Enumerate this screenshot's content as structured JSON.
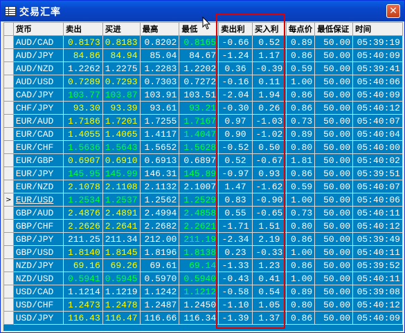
{
  "window": {
    "title": "交易汇率",
    "close_label": "✕"
  },
  "grid": {
    "headers": [
      "货币",
      "卖出",
      "买进",
      "最高",
      "最低",
      "卖出利",
      "买入利",
      "每点价",
      "最低保证",
      "时间"
    ],
    "current_row_marker": ">",
    "rows": [
      {
        "sym": "AUD/CAD",
        "bid": "0.8173",
        "ask": "0.8183",
        "high": "0.8202",
        "low": "0.8165",
        "sell": "-0.66",
        "buy": "0.52",
        "pt": "0.89",
        "margin": "50.00",
        "time": "05:39:19",
        "bidColor": "#ffff00",
        "askColor": "#ffff00",
        "highColor": "#ffffff",
        "lowColor": "#00ff40"
      },
      {
        "sym": "AUD/JPY",
        "bid": "84.86",
        "ask": "84.94",
        "high": "85.04",
        "low": "84.67",
        "sell": "-1.24",
        "buy": "1.17",
        "pt": "0.86",
        "margin": "50.00",
        "time": "05:40:09",
        "bidColor": "#ffff00",
        "askColor": "#ffff00",
        "highColor": "#ffffff",
        "lowColor": "#ffffff"
      },
      {
        "sym": "AUD/NZD",
        "bid": "1.2262",
        "ask": "1.2275",
        "high": "1.2283",
        "low": "1.2202",
        "sell": "0.36",
        "buy": "-0.39",
        "pt": "0.59",
        "margin": "50.00",
        "time": "05:39:41",
        "bidColor": "#ffffff",
        "askColor": "#ffffff",
        "highColor": "#ffffff",
        "lowColor": "#ffffff"
      },
      {
        "sym": "AUD/USD",
        "bid": "0.7289",
        "ask": "0.7293",
        "high": "0.7303",
        "low": "0.7272",
        "sell": "-0.16",
        "buy": "0.11",
        "pt": "1.00",
        "margin": "50.00",
        "time": "05:40:06",
        "bidColor": "#ffff00",
        "askColor": "#ffff00",
        "highColor": "#ffffff",
        "lowColor": "#ffffff"
      },
      {
        "sym": "CAD/JPY",
        "bid": "103.77",
        "ask": "103.87",
        "high": "103.91",
        "low": "103.51",
        "sell": "-2.04",
        "buy": "1.94",
        "pt": "0.86",
        "margin": "50.00",
        "time": "05:40:09",
        "bidColor": "#00ff40",
        "askColor": "#00ff40",
        "highColor": "#ffffff",
        "lowColor": "#ffffff"
      },
      {
        "sym": "CHF/JPY",
        "bid": "93.30",
        "ask": "93.39",
        "high": "93.61",
        "low": "93.21",
        "sell": "-0.30",
        "buy": "0.26",
        "pt": "0.86",
        "margin": "50.00",
        "time": "05:40:12",
        "bidColor": "#ffff00",
        "askColor": "#ffff00",
        "highColor": "#ffffff",
        "lowColor": "#00ff40"
      },
      {
        "sym": "EUR/AUD",
        "bid": "1.7186",
        "ask": "1.7201",
        "high": "1.7255",
        "low": "1.7167",
        "sell": "0.97",
        "buy": "-1.03",
        "pt": "0.73",
        "margin": "50.00",
        "time": "05:40:07",
        "bidColor": "#ffff00",
        "askColor": "#ffff00",
        "highColor": "#ffffff",
        "lowColor": "#00ff40"
      },
      {
        "sym": "EUR/CAD",
        "bid": "1.4055",
        "ask": "1.4065",
        "high": "1.4117",
        "low": "1.4047",
        "sell": "0.90",
        "buy": "-1.02",
        "pt": "0.89",
        "margin": "50.00",
        "time": "05:40:04",
        "bidColor": "#ffff00",
        "askColor": "#ffff00",
        "highColor": "#ffffff",
        "lowColor": "#00ff40"
      },
      {
        "sym": "EUR/CHF",
        "bid": "1.5636",
        "ask": "1.5643",
        "high": "1.5652",
        "low": "1.5628",
        "sell": "-0.52",
        "buy": "0.50",
        "pt": "0.80",
        "margin": "50.00",
        "time": "05:40:00",
        "bidColor": "#00ff40",
        "askColor": "#00ff40",
        "highColor": "#ffffff",
        "lowColor": "#00ff40"
      },
      {
        "sym": "EUR/GBP",
        "bid": "0.6907",
        "ask": "0.6910",
        "high": "0.6913",
        "low": "0.6897",
        "sell": "0.52",
        "buy": "-0.67",
        "pt": "1.81",
        "margin": "50.00",
        "time": "05:40:02",
        "bidColor": "#ffff00",
        "askColor": "#ffff00",
        "highColor": "#ffffff",
        "lowColor": "#ffffff"
      },
      {
        "sym": "EUR/JPY",
        "bid": "145.95",
        "ask": "145.99",
        "high": "146.31",
        "low": "145.89",
        "sell": "-0.97",
        "buy": "0.93",
        "pt": "0.86",
        "margin": "50.00",
        "time": "05:39:51",
        "bidColor": "#00ff40",
        "askColor": "#00ff40",
        "highColor": "#ffffff",
        "lowColor": "#00ff40"
      },
      {
        "sym": "EUR/NZD",
        "bid": "2.1078",
        "ask": "2.1108",
        "high": "2.1132",
        "low": "2.1007",
        "sell": "1.47",
        "buy": "-1.62",
        "pt": "0.59",
        "margin": "50.00",
        "time": "05:40:07",
        "bidColor": "#ffff00",
        "askColor": "#ffff00",
        "highColor": "#ffffff",
        "lowColor": "#ffffff"
      },
      {
        "sym": "EUR/USD",
        "bid": "1.2534",
        "ask": "1.2537",
        "high": "1.2562",
        "low": "1.2529",
        "sell": "0.83",
        "buy": "-0.90",
        "pt": "1.00",
        "margin": "50.00",
        "time": "05:40:06",
        "bidColor": "#00ff40",
        "askColor": "#00ff40",
        "highColor": "#ffffff",
        "lowColor": "#00ff40",
        "current": true
      },
      {
        "sym": "GBP/AUD",
        "bid": "2.4876",
        "ask": "2.4891",
        "high": "2.4994",
        "low": "2.4858",
        "sell": "0.55",
        "buy": "-0.65",
        "pt": "0.73",
        "margin": "50.00",
        "time": "05:40:11",
        "bidColor": "#ffff00",
        "askColor": "#ffff00",
        "highColor": "#ffffff",
        "lowColor": "#00ff40"
      },
      {
        "sym": "GBP/CHF",
        "bid": "2.2626",
        "ask": "2.2641",
        "high": "2.2682",
        "low": "2.2621",
        "sell": "-1.71",
        "buy": "1.51",
        "pt": "0.80",
        "margin": "50.00",
        "time": "05:40:12",
        "bidColor": "#ffff00",
        "askColor": "#ffff00",
        "highColor": "#ffffff",
        "lowColor": "#00ff40"
      },
      {
        "sym": "GBP/JPY",
        "bid": "211.25",
        "ask": "211.34",
        "high": "212.00",
        "low": "211.19",
        "sell": "-2.34",
        "buy": "2.19",
        "pt": "0.86",
        "margin": "50.00",
        "time": "05:39:49",
        "bidColor": "#ffffff",
        "askColor": "#ffffff",
        "highColor": "#ffffff",
        "lowColor": "#00ff40"
      },
      {
        "sym": "GBP/USD",
        "bid": "1.8140",
        "ask": "1.8145",
        "high": "1.8196",
        "low": "1.8138",
        "sell": "0.23",
        "buy": "-0.33",
        "pt": "1.00",
        "margin": "50.00",
        "time": "05:40:11",
        "bidColor": "#ffff00",
        "askColor": "#ffff00",
        "highColor": "#ffffff",
        "lowColor": "#00ff40"
      },
      {
        "sym": "NZD/JPY",
        "bid": "69.16",
        "ask": "69.26",
        "high": "69.61",
        "low": "69.14",
        "sell": "-1.33",
        "buy": "1.23",
        "pt": "0.86",
        "margin": "50.00",
        "time": "05:39:52",
        "bidColor": "#ffff00",
        "askColor": "#ffff00",
        "highColor": "#ffffff",
        "lowColor": "#00ff40"
      },
      {
        "sym": "NZD/USD",
        "bid": "0.5941",
        "ask": "0.5945",
        "high": "0.5970",
        "low": "0.5940",
        "sell": "-0.43",
        "buy": "0.41",
        "pt": "1.00",
        "margin": "50.00",
        "time": "05:40:11",
        "bidColor": "#00ff40",
        "askColor": "#00ff40",
        "highColor": "#ffffff",
        "lowColor": "#00ff40"
      },
      {
        "sym": "USD/CAD",
        "bid": "1.1214",
        "ask": "1.1219",
        "high": "1.1242",
        "low": "1.1212",
        "sell": "-0.58",
        "buy": "0.54",
        "pt": "0.89",
        "margin": "50.00",
        "time": "05:39:08",
        "bidColor": "#ffffff",
        "askColor": "#ffffff",
        "highColor": "#ffffff",
        "lowColor": "#00ff40"
      },
      {
        "sym": "USD/CHF",
        "bid": "1.2473",
        "ask": "1.2478",
        "high": "1.2487",
        "low": "1.2450",
        "sell": "-1.10",
        "buy": "1.05",
        "pt": "0.80",
        "margin": "50.00",
        "time": "05:40:12",
        "bidColor": "#ffff00",
        "askColor": "#ffff00",
        "highColor": "#ffffff",
        "lowColor": "#ffffff"
      },
      {
        "sym": "USD/JPY",
        "bid": "116.43",
        "ask": "116.47",
        "high": "116.66",
        "low": "116.34",
        "sell": "-1.39",
        "buy": "1.37",
        "pt": "0.86",
        "margin": "50.00",
        "time": "05:40:09",
        "bidColor": "#ffff00",
        "askColor": "#ffff00",
        "highColor": "#ffffff",
        "lowColor": "#ffffff"
      }
    ]
  },
  "colors": {
    "grid_bg": "#0080c0",
    "highlight_box": "#e00000"
  }
}
